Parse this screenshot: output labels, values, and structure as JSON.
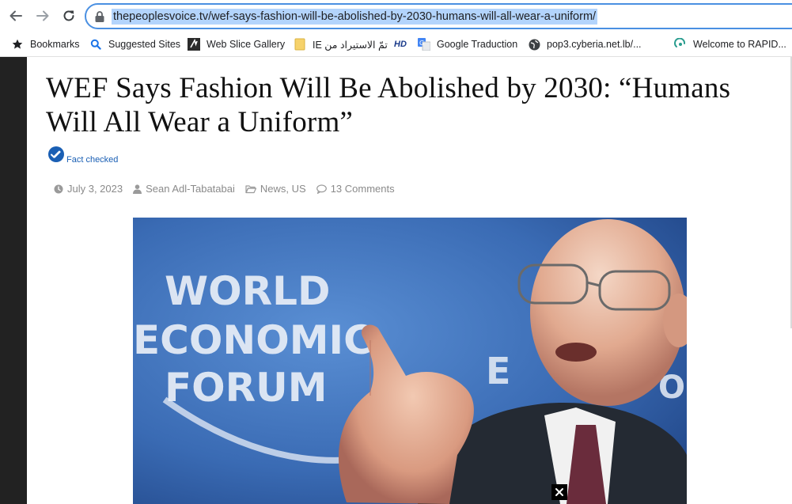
{
  "browser": {
    "url": "thepeoplesvoice.tv/wef-says-fashion-will-be-abolished-by-2030-humans-will-all-wear-a-uniform/",
    "nav": {
      "back_icon": "back-arrow-icon",
      "forward_icon": "forward-arrow-icon",
      "reload_icon": "reload-icon"
    }
  },
  "bookmarks": [
    {
      "label": "Bookmarks",
      "icon": "star-icon"
    },
    {
      "label": "Suggested Sites",
      "icon": "search-icon"
    },
    {
      "label": "Web Slice Gallery",
      "icon": "web-slice-icon"
    },
    {
      "label": "تمّ الاستيراد من IE",
      "icon": "folder-icon"
    },
    {
      "label": "",
      "icon": "hd-icon",
      "badge": "HD"
    },
    {
      "label": "Google Traduction",
      "icon": "translate-icon"
    },
    {
      "label": "pop3.cyberia.net.lb/...",
      "icon": "globe-icon"
    },
    {
      "label": "Welcome to RAPID...",
      "icon": "rapid-icon"
    }
  ],
  "article": {
    "headline_line1": "WEF Says Fashion Will Be Abolished by 2030: “Humans",
    "headline_line2": "Will All Wear a Uniform”",
    "fact_checked": "Fact checked",
    "date": "July 3, 2023",
    "author": "Sean Adl-Tabatabai",
    "category_1": "News",
    "category_sep": ", ",
    "category_2": "US",
    "comments": "13 Comments"
  },
  "photo": {
    "logo_line1": "WORLD",
    "logo_line2": "ECONOMIC",
    "logo_line3": "FORUM",
    "logo_right_1": "E",
    "logo_right_2": "O",
    "close_icon": "close-icon"
  },
  "colors": {
    "accent": "#4a90e2",
    "selection": "#b3d4fc",
    "fact_blue": "#1a5fb4",
    "photo_blue": "#3f6fb8"
  }
}
